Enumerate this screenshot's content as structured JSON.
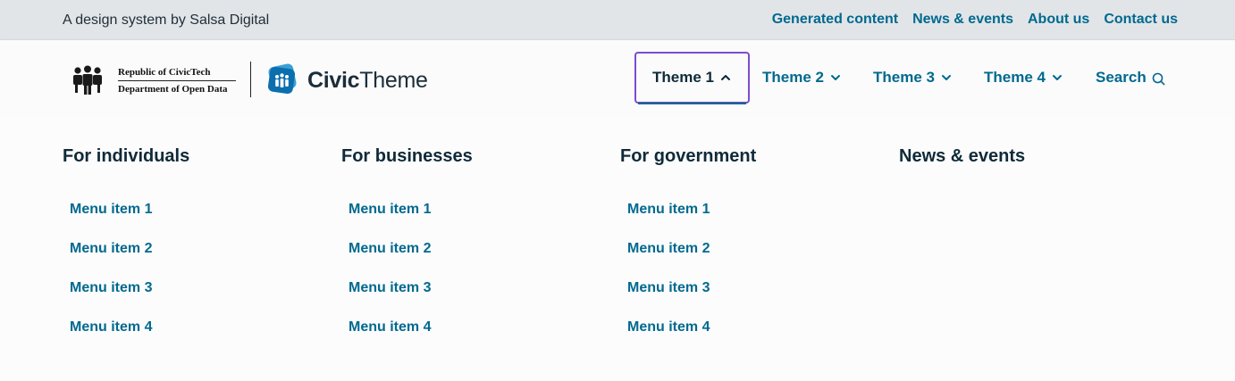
{
  "topbar": {
    "tagline": "A design system by Salsa Digital",
    "links": [
      "Generated content",
      "News & events",
      "About us",
      "Contact us"
    ]
  },
  "header": {
    "gov_logo_line1": "Republic of CivicTech",
    "gov_logo_line2": "Department of Open Data",
    "brand_bold": "Civic",
    "brand_regular": "Theme"
  },
  "nav": {
    "items": [
      "Theme 1",
      "Theme 2",
      "Theme 3",
      "Theme 4"
    ],
    "active_index": 0,
    "search_label": "Search"
  },
  "megamenu": {
    "columns": [
      {
        "title": "For individuals",
        "items": [
          "Menu item 1",
          "Menu item 2",
          "Menu item 3",
          "Menu item 4"
        ]
      },
      {
        "title": "For businesses",
        "items": [
          "Menu item 1",
          "Menu item 2",
          "Menu item 3",
          "Menu item 4"
        ]
      },
      {
        "title": "For government",
        "items": [
          "Menu item 1",
          "Menu item 2",
          "Menu item 3",
          "Menu item 4"
        ]
      },
      {
        "title": "News & events",
        "items": []
      }
    ]
  },
  "colors": {
    "link": "#00698f",
    "heading": "#0f2a38",
    "focus_outline": "#7d4ccf",
    "topbar_bg": "#e2e5e8"
  },
  "icons": {
    "chevron_up": "chevron-up-icon",
    "chevron_down": "chevron-down-icon",
    "search": "search-icon",
    "gov_logo": "people-group-icon",
    "brand_logo": "civictheme-logo-icon"
  }
}
